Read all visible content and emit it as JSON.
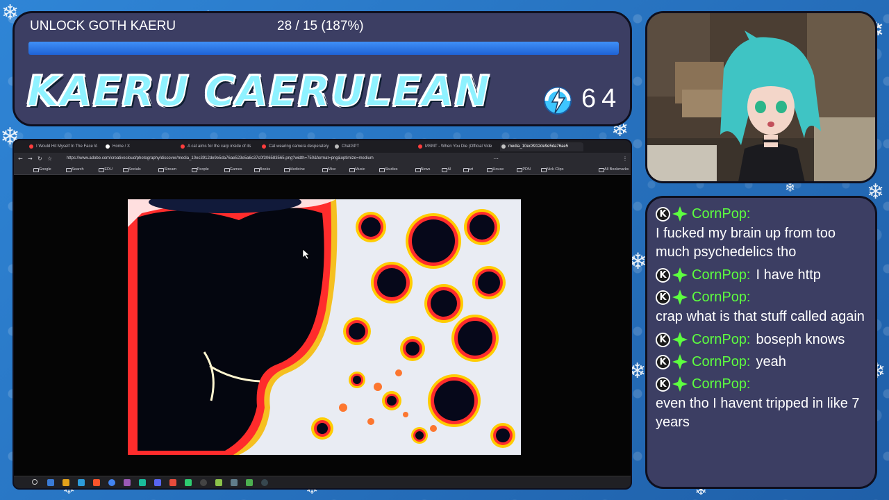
{
  "goal": {
    "label": "UNLOCK GOTH KAERU",
    "count_text": "28 / 15 (187%)",
    "progress_fraction": 1.0
  },
  "channel": {
    "name": "KAERU CAERULEAN",
    "points_icon": "channel-points-icon",
    "points_value": "64"
  },
  "browser": {
    "tabs": [
      {
        "label": "I Would Hit Myself In The Face Wit",
        "color": "#ff3d3d"
      },
      {
        "label": "Home / X",
        "color": "#ffffff"
      },
      {
        "label": "A cat aims for the carp inside of its",
        "color": "#ff3d3d"
      },
      {
        "label": "Cat wearing camera desperately sea",
        "color": "#ff3d3d"
      },
      {
        "label": "ChatGPT",
        "color": "#bbbbbb"
      },
      {
        "label": "MSMT - When You Die (Official Vide",
        "color": "#ff3d3d"
      },
      {
        "label": "media_10ec3912de9e5da76ae5",
        "color": "#c4c4c4",
        "active": true
      }
    ],
    "url": "https://www.adobe.com/creativecloud/photography/discover/media_10ec3912de9e5da76ae523e5a6c37c0f306583565.png?width=750&format=png&optimize=medium",
    "bookmarks": [
      "Google",
      "Search",
      "EDU",
      "Socials",
      "Stream",
      "People",
      "Games",
      "Books",
      "Medicine",
      "Misc",
      "Music",
      "Studies",
      "News",
      "AI",
      "art",
      "House",
      "PDN",
      "Nick Clips"
    ],
    "all_bookmarks": "All Bookmarks"
  },
  "chat": {
    "messages": [
      {
        "user": "CornPop:",
        "text": "I fucked my brain up from too much psychedelics tho",
        "inline": false
      },
      {
        "user": "CornPop:",
        "text": "I have http",
        "inline": true
      },
      {
        "user": "CornPop:",
        "text": "crap what is that stuff called again",
        "inline": false
      },
      {
        "user": "CornPop:",
        "text": "boseph knows",
        "inline": true
      },
      {
        "user": "CornPop:",
        "text": "yeah",
        "inline": true
      },
      {
        "user": "CornPop:",
        "text": "even tho I havent tripped in like 7 years",
        "inline": false
      }
    ],
    "username_color": "#5dff3f",
    "badges": [
      "k-badge-icon",
      "sparkle-star-icon"
    ]
  },
  "colors": {
    "panel": "#3c3e63",
    "accent": "#3f8ff7",
    "title": "#8ff2ff"
  }
}
